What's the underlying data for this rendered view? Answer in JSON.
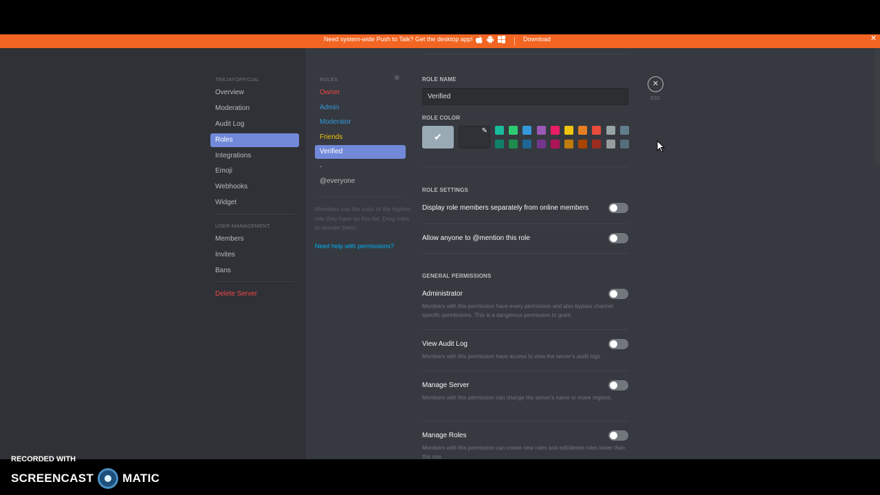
{
  "notice": {
    "message": "Need system-wide Push to Talk? Get the desktop app!",
    "download_label": "Download",
    "close_glyph": "✕",
    "platform_icons": [
      "apple-icon",
      "android-icon",
      "windows-icon"
    ]
  },
  "sidebar": {
    "server_name": "TEEJAYOFFICIAL",
    "items": [
      {
        "label": "Overview"
      },
      {
        "label": "Moderation"
      },
      {
        "label": "Audit Log"
      },
      {
        "label": "Roles",
        "active": true
      },
      {
        "label": "Integrations"
      },
      {
        "label": "Emoji"
      },
      {
        "label": "Webhooks"
      },
      {
        "label": "Widget"
      }
    ],
    "user_mgmt_header": "USER MANAGEMENT",
    "user_items": [
      {
        "label": "Members"
      },
      {
        "label": "Invites"
      },
      {
        "label": "Bans"
      }
    ],
    "delete_label": "Delete Server"
  },
  "roles": {
    "header": "ROLES",
    "add_glyph": "⊕",
    "list": [
      {
        "label": "Owner",
        "color": "#f04747"
      },
      {
        "label": "Admin",
        "color": "#3498db"
      },
      {
        "label": "Moderator",
        "color": "#3498db"
      },
      {
        "label": "Friends",
        "color": "#f1c40f"
      },
      {
        "label": "Verified",
        "color": "#ffffff",
        "active": true
      },
      {
        "label": "-",
        "color": "#b9bbbe"
      },
      {
        "label": "@everyone",
        "color": "#b9bbbe"
      }
    ],
    "hint": "Members use the color of the highest role they have on this list. Drag roles to reorder them!",
    "help_link": "Need help with permissions?"
  },
  "editor": {
    "role_name_label": "ROLE NAME",
    "role_name_value": "Verified",
    "role_color_label": "ROLE COLOR",
    "default_check": "✔",
    "picker_glyph": "✎",
    "colors_top": [
      "#1abc9c",
      "#2ecc71",
      "#3498db",
      "#9b59b6",
      "#e91e63",
      "#f1c40f",
      "#e67e22",
      "#e74c3c",
      "#95a5a6",
      "#607d8b"
    ],
    "colors_bottom": [
      "#11806a",
      "#1f8b4c",
      "#206694",
      "#71368a",
      "#ad1457",
      "#c27c0e",
      "#a84300",
      "#992d22",
      "#979c9f",
      "#546e7a"
    ],
    "role_settings_label": "ROLE SETTINGS",
    "settings": [
      {
        "label": "Display role members separately from online members",
        "enabled": false
      },
      {
        "label": "Allow anyone to @mention this role",
        "enabled": false
      }
    ],
    "general_permissions_label": "GENERAL PERMISSIONS",
    "permissions": [
      {
        "label": "Administrator",
        "desc": "Members with this permission have every permission and also bypass channel specific permissions. This is a dangerous permission to grant.",
        "enabled": false
      },
      {
        "label": "View Audit Log",
        "desc": "Members with this permission have access to view the server's audit logs",
        "enabled": false
      },
      {
        "label": "Manage Server",
        "desc": "Members with this permission can change the server's name or move regions.",
        "enabled": false
      },
      {
        "label": "Manage Roles",
        "desc": "Members with this permission can create new roles and edit/delete roles lower than this one.",
        "enabled": false
      }
    ],
    "close_glyph": "✕",
    "esc_label": "ESC"
  },
  "watermark": {
    "recorded_with": "RECORDED WITH",
    "brand_left": "SCREENCAST",
    "brand_right": "MATIC"
  }
}
